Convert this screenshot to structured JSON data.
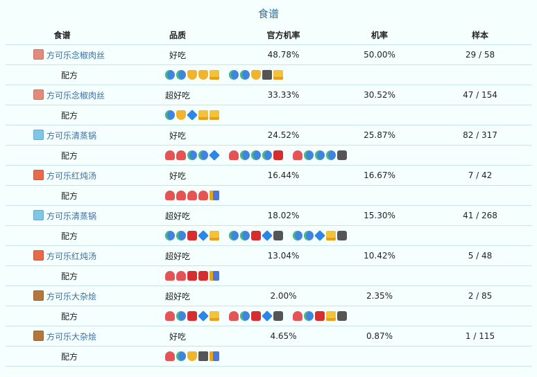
{
  "title": "食谱",
  "headers": [
    "食谱",
    "品质",
    "官方机率",
    "机率",
    "样本"
  ],
  "recipe_label": "配方",
  "rows": [
    {
      "dish": "方可乐念椒肉丝",
      "dish_icon_color": "#e58a7a",
      "quality": "好吃",
      "official_rate": "48.78%",
      "rate": "50.00%",
      "sample": "29 / 58",
      "recipes": [
        [
          "fish",
          "fish",
          "egg",
          "egg",
          "fruit"
        ],
        [
          "fish",
          "fish",
          "egg",
          "monster",
          "fruit"
        ]
      ]
    },
    {
      "dish": "方可乐念椒肉丝",
      "dish_icon_color": "#e58a7a",
      "quality": "超好吃",
      "official_rate": "33.33%",
      "rate": "30.52%",
      "sample": "47 / 154",
      "recipes": [
        [
          "fish",
          "egg",
          "gem",
          "fruit",
          "fruit"
        ]
      ]
    },
    {
      "dish": "方可乐清蒸锅",
      "dish_icon_color": "#7cc6e8",
      "quality": "好吃",
      "official_rate": "24.52%",
      "rate": "25.87%",
      "sample": "82 / 317",
      "recipes": [
        [
          "mushroom",
          "mushroom",
          "fish",
          "fish",
          "gem"
        ],
        [
          "mushroom",
          "fish",
          "fish",
          "fish",
          "meat"
        ],
        [
          "mushroom",
          "fish",
          "fish",
          "fish",
          "stone"
        ]
      ]
    },
    {
      "dish": "方可乐红炖汤",
      "dish_icon_color": "#e86a4a",
      "quality": "好吃",
      "official_rate": "16.44%",
      "rate": "16.67%",
      "sample": "7 / 42",
      "recipes": [
        [
          "mushroom",
          "mushroom",
          "mushroom",
          "mushroom",
          "misc"
        ]
      ]
    },
    {
      "dish": "方可乐清蒸锅",
      "dish_icon_color": "#7cc6e8",
      "quality": "超好吃",
      "official_rate": "18.02%",
      "rate": "15.30%",
      "sample": "41 / 268",
      "recipes": [
        [
          "fish",
          "fish",
          "meat",
          "gem",
          "fruit"
        ],
        [
          "fish",
          "fish",
          "meat",
          "gem",
          "stone"
        ],
        [
          "fish",
          "fish",
          "gem",
          "fruit",
          "stone"
        ]
      ]
    },
    {
      "dish": "方可乐红炖汤",
      "dish_icon_color": "#e86a4a",
      "quality": "超好吃",
      "official_rate": "13.04%",
      "rate": "10.42%",
      "sample": "5 / 48",
      "recipes": [
        [
          "mushroom",
          "mushroom",
          "meat",
          "meat",
          "misc"
        ]
      ]
    },
    {
      "dish": "方可乐大杂烩",
      "dish_icon_color": "#b4763a",
      "quality": "超好吃",
      "official_rate": "2.00%",
      "rate": "2.35%",
      "sample": "2 / 85",
      "recipes": [
        [
          "mushroom",
          "fish",
          "meat",
          "gem",
          "fruit"
        ],
        [
          "mushroom",
          "fish",
          "meat",
          "gem",
          "stone"
        ],
        [
          "mushroom",
          "fish",
          "meat",
          "fruit",
          "stone"
        ]
      ]
    },
    {
      "dish": "方可乐大杂烩",
      "dish_icon_color": "#b4763a",
      "quality": "好吃",
      "official_rate": "4.65%",
      "rate": "0.87%",
      "sample": "1 / 115",
      "recipes": [
        [
          "mushroom",
          "fish",
          "egg",
          "monster",
          "misc"
        ]
      ]
    }
  ]
}
